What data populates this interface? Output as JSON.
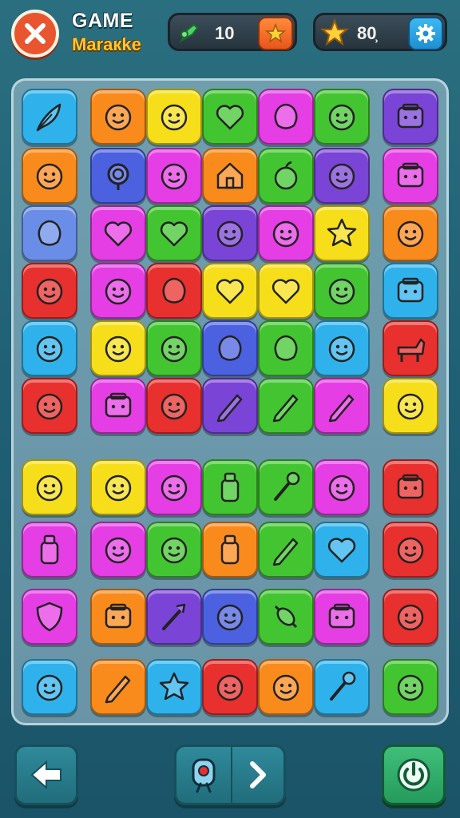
{
  "header": {
    "title_line1": "GAME",
    "title_line2": "Maraкke",
    "gems_value": "10",
    "stars_value": "80̹",
    "icons": {
      "close": "close-icon",
      "gem": "gem-icon",
      "add_star": "star-icon",
      "coin_star": "star-icon",
      "settings": "gear-icon",
      "back": "back-arrow-icon",
      "hint": "magnifier-icon",
      "next": "chevron-right-icon",
      "power": "power-icon"
    }
  },
  "colors": {
    "red": "#e8302e",
    "orange": "#f98a1c",
    "yellow": "#f6df1a",
    "green": "#43c531",
    "cyan": "#2fb2ec",
    "blue": "#4b61e0",
    "purple": "#7a44d6",
    "magenta": "#e53ee4",
    "periwinkle": "#6a8ee8"
  },
  "board": {
    "rows": [
      [
        {
          "c": "cyan",
          "i": "feather"
        },
        {
          "c": "orange",
          "i": "face"
        },
        {
          "c": "yellow",
          "i": "face"
        },
        {
          "c": "green",
          "i": "heart"
        },
        {
          "c": "magenta",
          "i": "blob"
        },
        {
          "c": "green",
          "i": "face"
        },
        {
          "c": "purple",
          "i": "box"
        }
      ],
      [
        {
          "c": "orange",
          "i": "face"
        },
        {
          "c": "blue",
          "i": "ring"
        },
        {
          "c": "magenta",
          "i": "face"
        },
        {
          "c": "orange",
          "i": "house"
        },
        {
          "c": "green",
          "i": "apple"
        },
        {
          "c": "purple",
          "i": "face"
        },
        {
          "c": "magenta",
          "i": "box"
        }
      ],
      [
        {
          "c": "periwinkle",
          "i": "blob"
        },
        {
          "c": "magenta",
          "i": "heart"
        },
        {
          "c": "green",
          "i": "heart"
        },
        {
          "c": "purple",
          "i": "face"
        },
        {
          "c": "magenta",
          "i": "face"
        },
        {
          "c": "yellow",
          "i": "star"
        },
        {
          "c": "orange",
          "i": "face"
        }
      ],
      [
        {
          "c": "red",
          "i": "face"
        },
        {
          "c": "magenta",
          "i": "face"
        },
        {
          "c": "red",
          "i": "blob"
        },
        {
          "c": "yellow",
          "i": "heart"
        },
        {
          "c": "yellow",
          "i": "heart"
        },
        {
          "c": "green",
          "i": "face"
        },
        {
          "c": "cyan",
          "i": "box"
        }
      ],
      [
        {
          "c": "cyan",
          "i": "face"
        },
        {
          "c": "yellow",
          "i": "face"
        },
        {
          "c": "green",
          "i": "face"
        },
        {
          "c": "blue",
          "i": "blob"
        },
        {
          "c": "green",
          "i": "blob"
        },
        {
          "c": "cyan",
          "i": "face"
        },
        {
          "c": "red",
          "i": "animal"
        }
      ],
      [
        {
          "c": "red",
          "i": "face"
        },
        {
          "c": "magenta",
          "i": "box"
        },
        {
          "c": "red",
          "i": "face"
        },
        {
          "c": "purple",
          "i": "pencil"
        },
        {
          "c": "green",
          "i": "pencil"
        },
        {
          "c": "magenta",
          "i": "pencil"
        },
        {
          "c": "yellow",
          "i": "face"
        }
      ],
      [
        {
          "c": "yellow",
          "i": "face"
        },
        {
          "c": "yellow",
          "i": "face"
        },
        {
          "c": "magenta",
          "i": "face"
        },
        {
          "c": "green",
          "i": "bottle"
        },
        {
          "c": "green",
          "i": "pin"
        },
        {
          "c": "magenta",
          "i": "face"
        },
        {
          "c": "red",
          "i": "box"
        }
      ],
      [
        {
          "c": "magenta",
          "i": "bottle"
        },
        {
          "c": "magenta",
          "i": "face"
        },
        {
          "c": "green",
          "i": "face"
        },
        {
          "c": "orange",
          "i": "bottle"
        },
        {
          "c": "green",
          "i": "pencil"
        },
        {
          "c": "cyan",
          "i": "heart"
        },
        {
          "c": "red",
          "i": "face"
        }
      ],
      [
        {
          "c": "magenta",
          "i": "shield"
        },
        {
          "c": "orange",
          "i": "box"
        },
        {
          "c": "purple",
          "i": "wand"
        },
        {
          "c": "blue",
          "i": "face"
        },
        {
          "c": "green",
          "i": "candy"
        },
        {
          "c": "magenta",
          "i": "box"
        },
        {
          "c": "red",
          "i": "face"
        }
      ],
      [
        {
          "c": "cyan",
          "i": "face"
        },
        {
          "c": "orange",
          "i": "pencil"
        },
        {
          "c": "cyan",
          "i": "star"
        },
        {
          "c": "red",
          "i": "face"
        },
        {
          "c": "orange",
          "i": "face"
        },
        {
          "c": "cyan",
          "i": "pin"
        },
        {
          "c": "green",
          "i": "face"
        }
      ]
    ]
  }
}
